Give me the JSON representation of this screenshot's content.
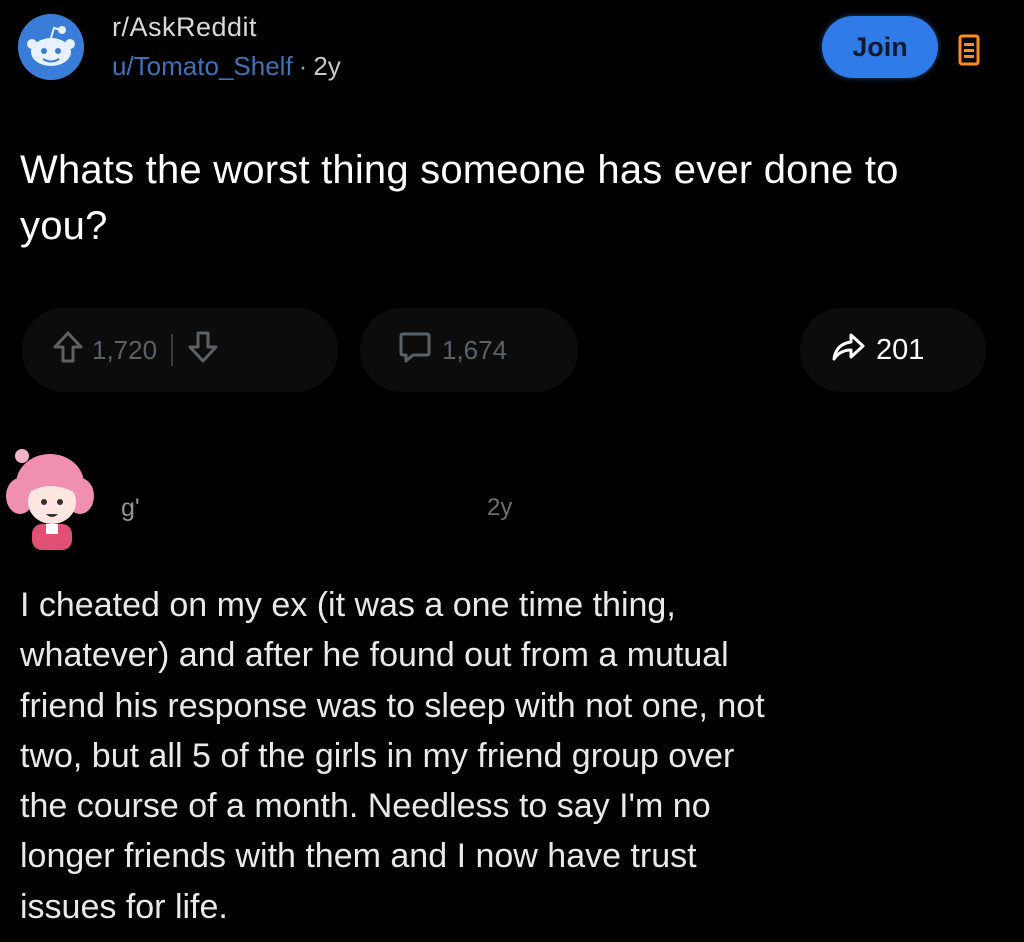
{
  "header": {
    "subreddit": "r/AskReddit",
    "username": "u/Tomato_Shelf",
    "separator": "·",
    "age": "2y",
    "join_label": "Join",
    "more_icon": "more-options-icon"
  },
  "post": {
    "title": "Whats the worst thing someone has ever done to you?"
  },
  "actions": {
    "upvote_icon": "upvote-arrow-icon",
    "votes": "1,720",
    "downvote_icon": "downvote-arrow-icon",
    "comment_icon": "comment-bubble-icon",
    "comments": "1,674",
    "share_icon": "share-arrow-icon",
    "shares": "201"
  },
  "comment": {
    "username": "g'",
    "age": "2y",
    "lines": [
      "I cheated on my ex (it was a one time thing,",
      "whatever) and after he found out from a mutual",
      "friend his response was to sleep with not one, not",
      "two, but all 5 of the girls in my friend group over",
      "the course of a month. Needless to say I'm no",
      "longer friends with them and I now have trust",
      "issues for life."
    ]
  },
  "colors": {
    "background": "#000000",
    "join_button": "#2f7ce8",
    "username_link": "#3f72b8",
    "muted_text": "#5c6166"
  }
}
